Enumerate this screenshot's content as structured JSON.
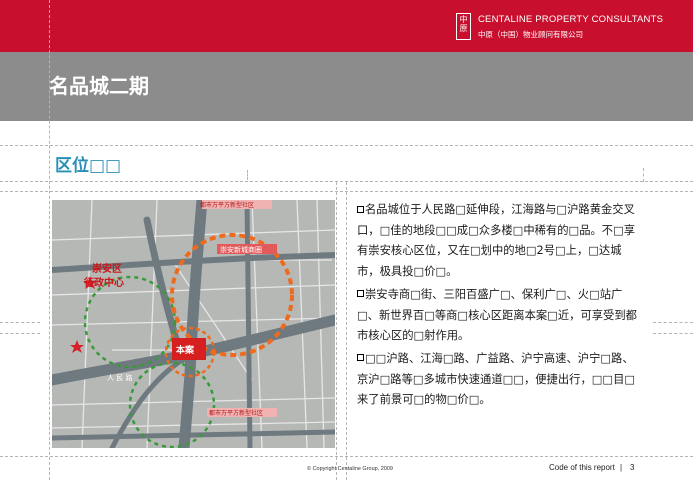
{
  "colors": {
    "brand_red": "#c8102e",
    "title_bar_gray": "#8c8c8c",
    "heading_blue": "#2a8fb7"
  },
  "header": {
    "logo_glyphs": "中原",
    "brand_en": "CENTALINE  PROPERTY  CONSULTANTS",
    "brand_cn": "中原（中国）物业顾问有限公司"
  },
  "title": {
    "text": "名品城二期"
  },
  "section": {
    "heading": "区位□□"
  },
  "map": {
    "labels": {
      "district_center_1": "崇安区",
      "district_center_2": "行政中心",
      "project_marker": "本案",
      "new_city": "崇安新城商圈",
      "wanda_top": "都市万平方新型社区",
      "wanda_bottom": "都市万平方新型社区",
      "renmin_road": "人 民 路"
    }
  },
  "body": {
    "paragraphs": [
      "名品城位于人民路□延伸段，江海路与□沪路黄金交叉口，□佳的地段□□成□众多楼□中稀有的□品。不□享有崇安核心区位，又在□划中的地□2号□上，□达城市，极具投□价□。",
      "崇安寺商□街、三阳百盛广□、保利广□、火□站广□、新世界百□等商□核心区距离本案□近，可享受到都市核心区的□射作用。",
      "□□沪路、江海□路、广益路、沪宁高速、沪宁□路、京沪□路等□多城市快速通道□□，便捷出行，□□目□来了前景可□的物□价□。"
    ]
  },
  "footer": {
    "copyright": "© Copyright  Centaline Group, 2009",
    "code_label": "Code of this report",
    "separator": "|",
    "page": "3"
  }
}
